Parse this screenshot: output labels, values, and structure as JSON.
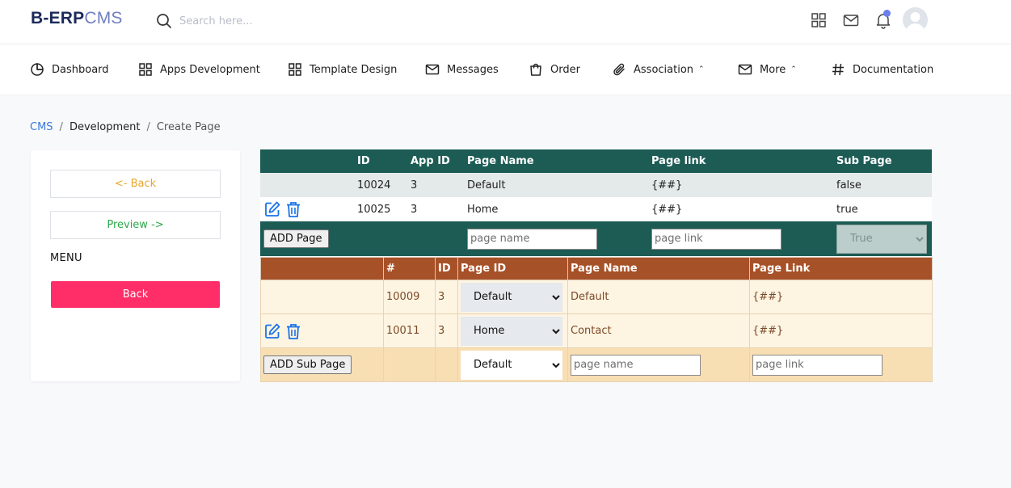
{
  "brand": {
    "part1": "B-ERP",
    "part2": "CMS"
  },
  "search": {
    "placeholder": "Search here..."
  },
  "topbar_icons": [
    "grid-icon",
    "mail-icon",
    "bell-icon",
    "avatar"
  ],
  "nav": {
    "items": [
      {
        "label": "Dashboard",
        "icon": "pie-chart-icon"
      },
      {
        "label": "Apps Development",
        "icon": "grid-icon"
      },
      {
        "label": "Template Design",
        "icon": "grid-icon"
      },
      {
        "label": "Messages",
        "icon": "mail-icon"
      },
      {
        "label": "Order",
        "icon": "shopping-bag-icon"
      },
      {
        "label": "Association",
        "icon": "paperclip-icon",
        "caret": "^"
      },
      {
        "label": "More",
        "icon": "mail-icon",
        "caret": "^"
      },
      {
        "label": "Documentation",
        "icon": "hash-icon"
      }
    ]
  },
  "breadcrumb": {
    "root": "CMS",
    "sep": "/",
    "middle": "Development",
    "current": "Create Page"
  },
  "left_panel": {
    "back_label": "<- Back",
    "preview_label": "Preview ->",
    "menu_label": "MENU",
    "red_back_label": "Back"
  },
  "pages_table": {
    "headers": [
      "",
      "ID",
      "App ID",
      "Page Name",
      "Page link",
      "Sub Page"
    ],
    "rows": [
      {
        "id": "10024",
        "app_id": "3",
        "page_name": "Default",
        "page_link": "{##}",
        "sub_page": "false",
        "has_actions": false
      },
      {
        "id": "10025",
        "app_id": "3",
        "page_name": "Home",
        "page_link": "{##}",
        "sub_page": "true",
        "has_actions": true
      }
    ],
    "add_button_label": "ADD Page",
    "page_name_placeholder": "page name",
    "page_link_placeholder": "page link",
    "sub_page_select_value": "True"
  },
  "sub_table": {
    "headers": [
      "",
      "#",
      "ID",
      "Page ID",
      "Page Name",
      "Page Link"
    ],
    "rows": [
      {
        "num": "10009",
        "id": "3",
        "page_id": "Default",
        "page_name": "Default",
        "page_link": "{##}",
        "has_actions": false
      },
      {
        "num": "10011",
        "id": "3",
        "page_id": "Home",
        "page_name": "Contact",
        "page_link": "{##}",
        "has_actions": true
      }
    ],
    "add_button_label": "ADD Sub Page",
    "page_id_select_value": "Default",
    "page_name_placeholder": "page name",
    "page_link_placeholder": "page link"
  },
  "colors": {
    "brand_dark": "#1b2a5a",
    "brand_light": "#6f7fbf",
    "table_green": "#1c5c55",
    "table_brown": "#a75128",
    "sub_row_bg": "#fef4e2",
    "sub_add_bg": "#f8deb3",
    "danger": "#ff2e68",
    "warning": "#e6a72a",
    "success": "#2aa84a",
    "link": "#3a78d8",
    "action_blue": "#1a73e8"
  }
}
